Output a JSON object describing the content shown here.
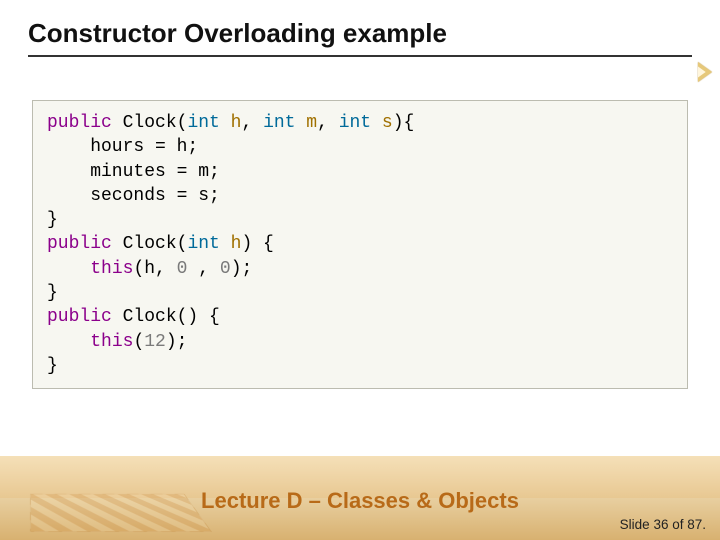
{
  "title": "Constructor Overloading example",
  "code": {
    "l1": {
      "kw": "public",
      "name": " Clock(",
      "t1": "int",
      "p1": " h",
      "c1": ", ",
      "t2": "int",
      "p2": " m",
      "c2": ", ",
      "t3": "int",
      "p3": " s",
      "tail": "){"
    },
    "l2": "    hours = h;",
    "l3": "    minutes = m;",
    "l4": "    seconds = s;",
    "l5": "}",
    "l6": {
      "kw": "public",
      "name": " Clock(",
      "t1": "int",
      "p1": " h",
      "tail": ") {"
    },
    "l7": {
      "indent": "    ",
      "call": "this",
      "open": "(h, ",
      "n1": "0",
      "sep": " , ",
      "n2": "0",
      "close": ");"
    },
    "l8": "}",
    "l9": {
      "kw": "public",
      "name": " Clock() {"
    },
    "l10": {
      "indent": "    ",
      "call": "this",
      "open": "(",
      "n1": "12",
      "close": ");"
    },
    "l11": "}"
  },
  "footer": {
    "lecture": "Lecture D – Classes & Objects",
    "slide_label": "Slide 36 of 87."
  }
}
